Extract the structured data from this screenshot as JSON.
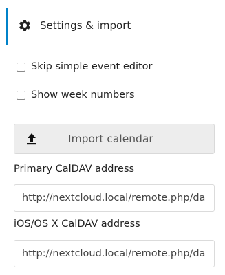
{
  "settings": {
    "header": {
      "title": "Settings & import",
      "icon": "gear-icon",
      "accent_color": "#0082c9"
    },
    "options": [
      {
        "label": "Skip simple event editor",
        "checked": false
      },
      {
        "label": "Show week numbers",
        "checked": false
      }
    ],
    "import": {
      "label": "Import calendar",
      "icon": "upload-icon"
    },
    "caldav": {
      "primary_label": "Primary CalDAV address",
      "primary_value": "http://nextcloud.local/remote.php/dav",
      "ios_label": "iOS/OS X CalDAV address",
      "ios_value": "http://nextcloud.local/remote.php/dav/principals/users/admin/"
    }
  }
}
